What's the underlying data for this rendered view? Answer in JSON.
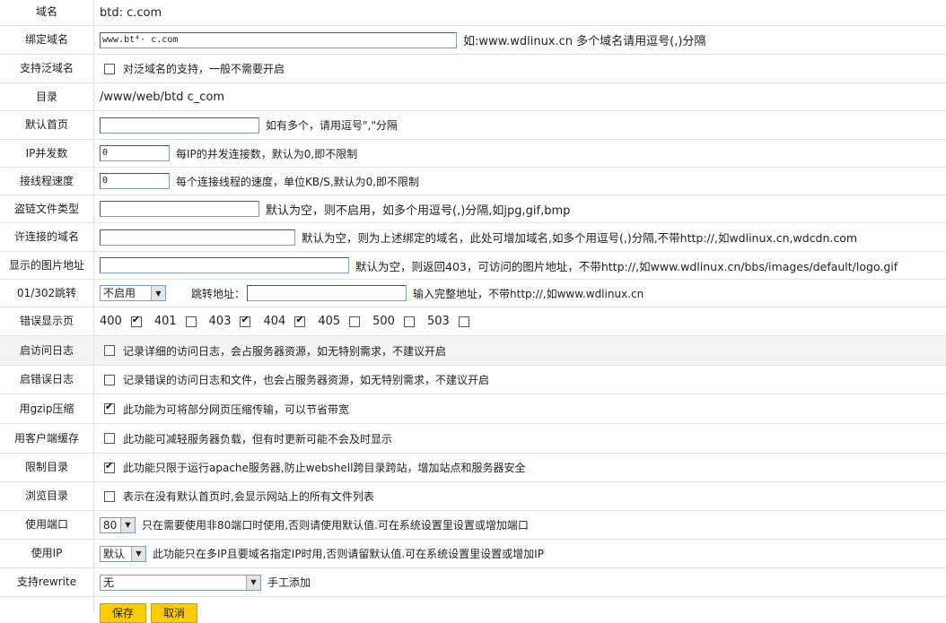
{
  "domain_name": {
    "label": "域名",
    "value": "btd:    c.com"
  },
  "bind_domain": {
    "label": "绑定域名",
    "value": "www.bt⁴·   c.com",
    "hint": "如:www.wdlinux.cn 多个域名请用逗号(,)分隔"
  },
  "wildcard": {
    "label": "支持泛域名",
    "checked": false,
    "hint": "对泛域名的支持，一般不需要开启"
  },
  "directory": {
    "label": "目录",
    "value": "/www/web/btd     c_com"
  },
  "default_page": {
    "label": "默认首页",
    "value": "",
    "hint": "如有多个，请用逗号\",\"分隔"
  },
  "ip_concurrency": {
    "label": "IP并发数",
    "value": "0",
    "hint": "每IP的并发连接数，默认为0,即不限制"
  },
  "thread_speed": {
    "label": "接线程速度",
    "value": "0",
    "hint": "每个连接线程的速度，单位KB/S,默认为0,即不限制"
  },
  "hotlink_types": {
    "label": "盗链文件类型",
    "value": "",
    "hint": "默认为空，则不启用，如多个用逗号(,)分隔,如jpg,gif,bmp"
  },
  "allowed_domains": {
    "label": "许连接的域名",
    "value": "",
    "hint": "默认为空，则为上述绑定的域名，此处可增加域名,如多个用逗号(,)分隔,不带http://,如wdlinux.cn,wdcdn.com"
  },
  "hotlink_image": {
    "label": "显示的图片地址",
    "value": "",
    "hint": "默认为空，则返回403，可访问的图片地址，不带http://,如www.wdlinux.cn/bbs/images/default/logo.gif"
  },
  "redirect": {
    "label": "01/302跳转",
    "select_value": "不启用",
    "url_label": "跳转地址：",
    "url_value": "",
    "hint": "输入完整地址，不带http://,如www.wdlinux.cn"
  },
  "error_pages": {
    "label": "错误显示页",
    "codes": [
      {
        "code": "400",
        "checked": true
      },
      {
        "code": "401",
        "checked": false
      },
      {
        "code": "403",
        "checked": true
      },
      {
        "code": "404",
        "checked": true
      },
      {
        "code": "405",
        "checked": false
      },
      {
        "code": "500",
        "checked": false
      },
      {
        "code": "503",
        "checked": false
      }
    ]
  },
  "access_log": {
    "label": "启访问日志",
    "checked": false,
    "hint": "记录详细的访问日志，会占服务器资源，如无特别需求，不建议开启"
  },
  "error_log": {
    "label": "启错误日志",
    "checked": false,
    "hint": "记录错误的访问日志和文件，也会占服务器资源，如无特别需求，不建议开启"
  },
  "gzip": {
    "label": "用gzip压缩",
    "checked": true,
    "hint": "此功能为可将部分网页压缩传输，可以节省带宽"
  },
  "client_cache": {
    "label": "用客户端缓存",
    "checked": false,
    "hint": "此功能可减轻服务器负载，但有时更新可能不会及时显示"
  },
  "restrict_dir": {
    "label": "限制目录",
    "checked": true,
    "hint": "此功能只限于运行apache服务器,防止webshell跨目录跨站，增加站点和服务器安全"
  },
  "browse_dir": {
    "label": "浏览目录",
    "checked": false,
    "hint": "表示在没有默认首页时,会显示网站上的所有文件列表"
  },
  "port": {
    "label": "使用端口",
    "select_value": "80",
    "hint": "只在需要使用非80端口时使用,否则请使用默认值.可在系统设置里设置或增加端口"
  },
  "use_ip": {
    "label": "使用IP",
    "select_value": "默认",
    "hint": "此功能只在多IP且要域名指定IP时用,否则请留默认值.可在系统设置里设置或增加IP"
  },
  "rewrite": {
    "label": "支持rewrite",
    "select_value": "无",
    "hint": "手工添加"
  },
  "buttons": {
    "save": "保存",
    "cancel": "取消"
  }
}
